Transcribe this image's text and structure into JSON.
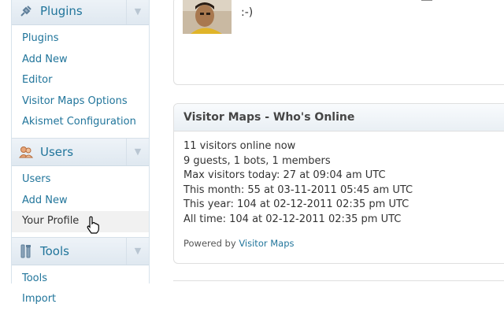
{
  "sidebar": {
    "menus": [
      {
        "title": "Plugins",
        "icon": "plug-icon",
        "items": [
          "Plugins",
          "Add New",
          "Editor",
          "Visitor Maps Options",
          "Akismet Configuration"
        ]
      },
      {
        "title": "Users",
        "icon": "users-icon",
        "items": [
          "Users",
          "Add New",
          "Your Profile"
        ],
        "current_item": "Your Profile"
      },
      {
        "title": "Tools",
        "icon": "tools-icon",
        "items": [
          "Tools",
          "Import"
        ]
      }
    ]
  },
  "comment": {
    "text": ":-)"
  },
  "widget": {
    "title": "Visitor Maps - Who's Online",
    "stats": [
      "11 visitors online now",
      "9 guests, 1 bots, 1 members",
      "Max visitors today: 27 at 09:04 am UTC",
      "This month: 55 at 03-11-2011 05:45 am UTC",
      "This year: 104 at 02-12-2011 02:35 pm UTC",
      "All time: 104 at 02-12-2011 02:35 pm UTC"
    ],
    "powered_prefix": "Powered by",
    "powered_link": "Visitor Maps"
  },
  "colors": {
    "link": "#21759b",
    "menu_head_bg": "#e4ecf3"
  }
}
